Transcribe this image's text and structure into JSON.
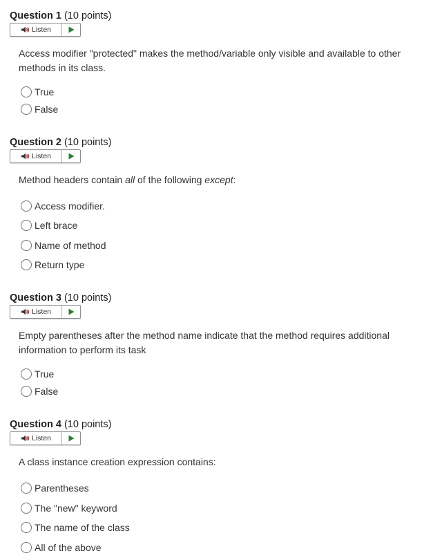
{
  "listen_label": "Listen",
  "questions": [
    {
      "title": "Question 1",
      "points": "(10 points)",
      "prompt": "Access modifier \"protected\" makes the method/variable only visible and available to other methods in its class.",
      "options": [
        "True",
        "False"
      ]
    },
    {
      "title": "Question 2",
      "points": "(10 points)",
      "prompt_parts": [
        "Method headers contain ",
        "all",
        " of the following ",
        "except",
        ":"
      ],
      "options": [
        "Access modifier.",
        "Left brace",
        "Name of method",
        "Return type"
      ]
    },
    {
      "title": "Question 3",
      "points": "(10 points)",
      "prompt": "Empty parentheses after the method name indicate that the method requires additional information to perform its task",
      "options": [
        "True",
        "False"
      ]
    },
    {
      "title": "Question 4",
      "points": "(10 points)",
      "prompt": "A class instance creation expression contains:",
      "options": [
        "Parentheses",
        "The \"new\" keyword",
        "The name of the class",
        "All of the above"
      ]
    }
  ]
}
